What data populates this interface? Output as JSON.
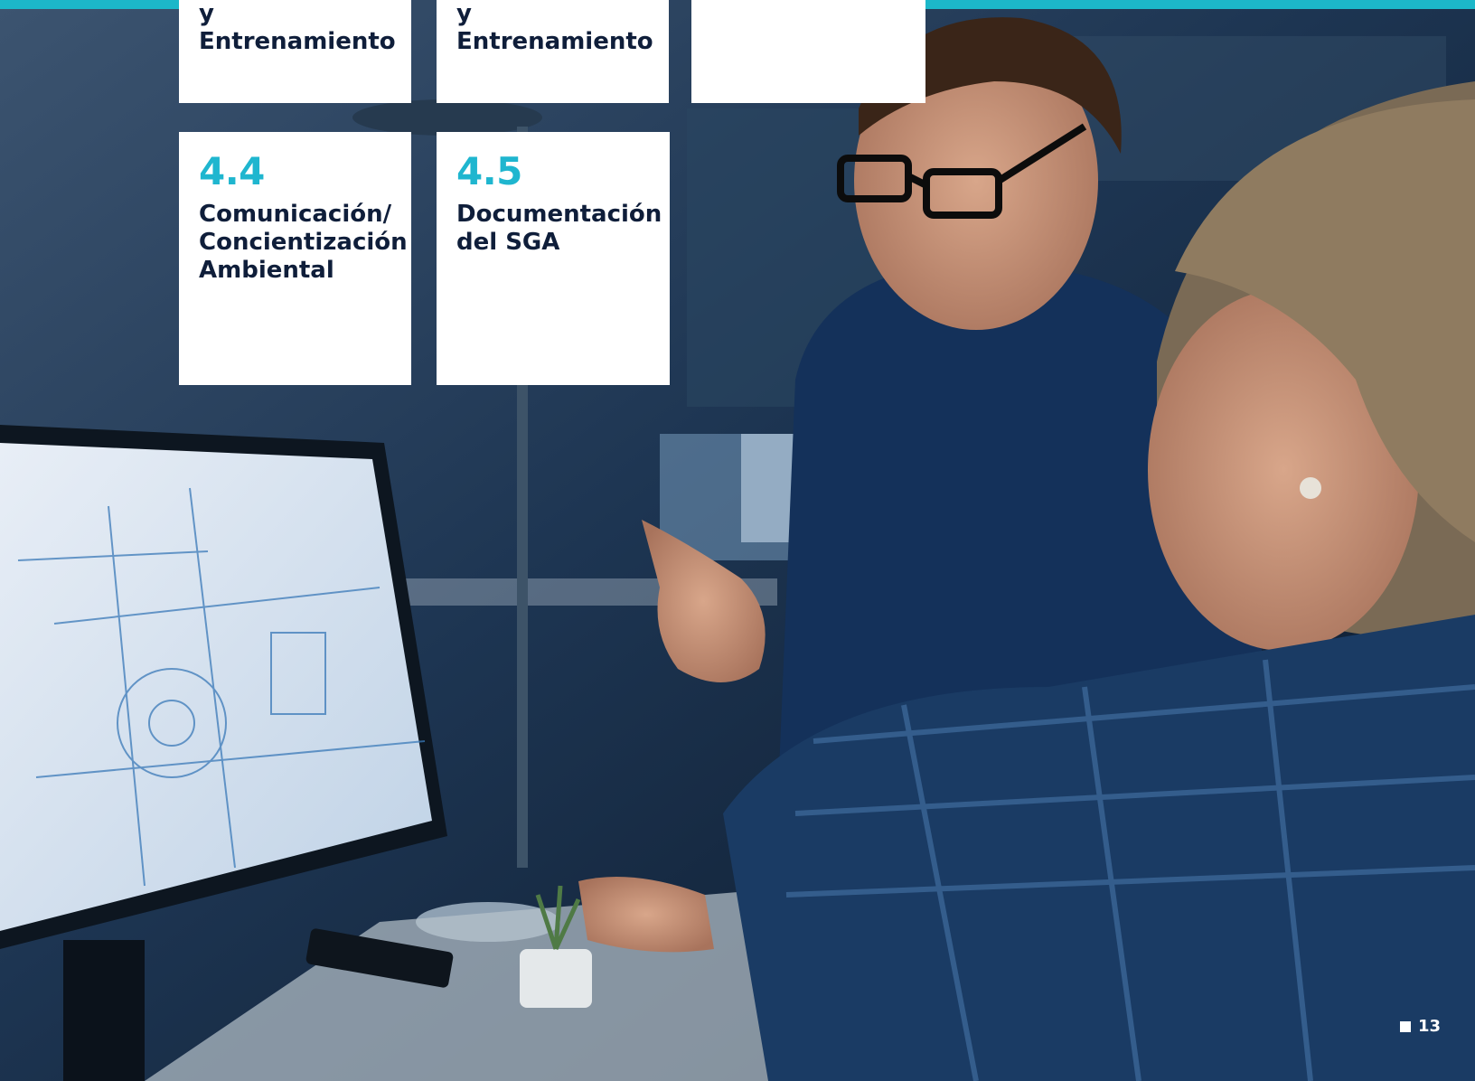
{
  "cards_top": [
    {
      "title": "y Entrenamiento"
    },
    {
      "title": "y Entrenamiento"
    },
    {
      "title": ""
    }
  ],
  "cards_bottom": [
    {
      "number": "4.4",
      "title": "Comunicación/\nConcientización\nAmbiental"
    },
    {
      "number": "4.5",
      "title": "Documentación\ndel SGA"
    }
  ],
  "page_number": "13",
  "colors": {
    "accent": "#1fb6cf",
    "card_text": "#0f1e3a",
    "card_bg": "#ffffff"
  }
}
